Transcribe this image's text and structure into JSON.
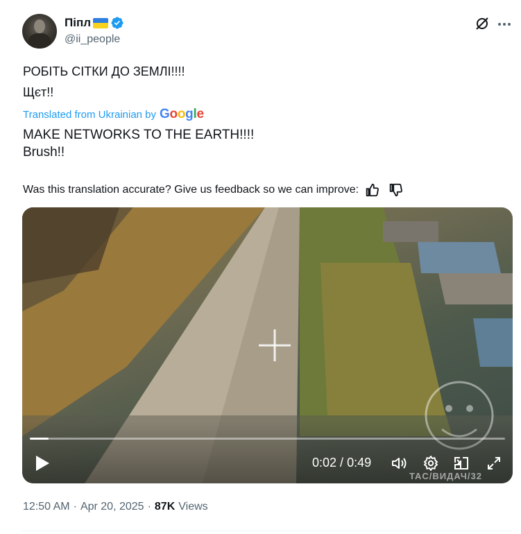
{
  "author": {
    "display_name": "Піпл",
    "handle": "@ii_people"
  },
  "tweet": {
    "original_lines": [
      "РОБІТЬ СІТКИ ДО ЗЕМЛІ!!!!",
      "Щєт!!"
    ],
    "translated_from": "Translated from Ukrainian by",
    "translated_lines": [
      "MAKE NETWORKS TO THE EARTH!!!!",
      "Brush!!"
    ],
    "feedback_prompt": "Was this translation accurate? Give us feedback so we can improve:"
  },
  "video": {
    "current_time": "0:02",
    "separator": "/",
    "duration": "0:49",
    "progress_fraction": 0.04,
    "watermark": "TAC/ВИДАЧ/32"
  },
  "footer": {
    "time": "12:50 AM",
    "dot1": "·",
    "date": "Apr 20, 2025",
    "dot2": "·",
    "views_count": "87K",
    "views_label": "Views"
  },
  "colors": {
    "link_blue": "#1d9bf0",
    "secondary_text": "#536471",
    "verified_blue": "#1d9bf0"
  },
  "icons": {
    "grok": "grok-icon",
    "more": "more-icon",
    "thumbs_up": "thumbs-up-icon",
    "thumbs_down": "thumbs-down-icon",
    "play": "play-icon",
    "volume": "volume-icon",
    "settings": "gear-icon",
    "pip": "picture-in-picture-icon",
    "fullscreen": "fullscreen-icon"
  }
}
